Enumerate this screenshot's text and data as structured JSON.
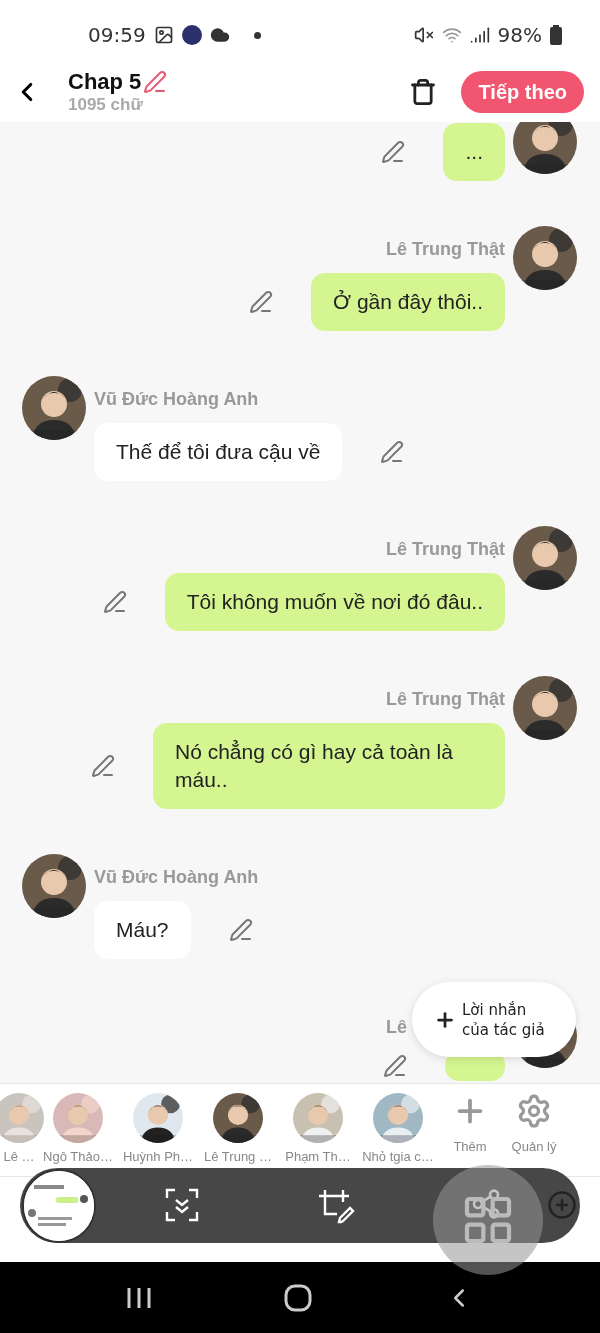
{
  "status_bar": {
    "time": "09:59",
    "battery": "98%"
  },
  "header": {
    "title": "Chap 5",
    "word_count": "1095 chữ",
    "next_button": "Tiếp theo"
  },
  "messages": [
    {
      "kind": "outgoing",
      "text": "..."
    },
    {
      "kind": "outgoing",
      "name": "Lê Trung Thật",
      "text": "Ở gần đây thôi.."
    },
    {
      "kind": "incoming",
      "name": "Vũ Đức Hoàng Anh",
      "text": "Thế để tôi đưa cậu về"
    },
    {
      "kind": "outgoing",
      "name": "Lê Trung Thật",
      "text": "Tôi không muốn về nơi đó đâu.."
    },
    {
      "kind": "outgoing",
      "name": "Lê Trung Thật",
      "text": "Nó chẳng có gì hay cả toàn là máu.."
    },
    {
      "kind": "incoming",
      "name": "Vũ Đức Hoàng Anh",
      "text": "Máu?"
    },
    {
      "kind": "outgoing",
      "name": "Lê"
    }
  ],
  "author_note_button": "Lời nhắn của tác giả",
  "characters": [
    {
      "name": "Lê …"
    },
    {
      "name": "Ngô Thảo…"
    },
    {
      "name": "Huỳnh Ph…"
    },
    {
      "name": "Lê Trung …"
    },
    {
      "name": "Phạm Th…"
    },
    {
      "name": "Nhỏ tgia c…"
    }
  ],
  "add_label": "Thêm",
  "manage_label": "Quản lý"
}
